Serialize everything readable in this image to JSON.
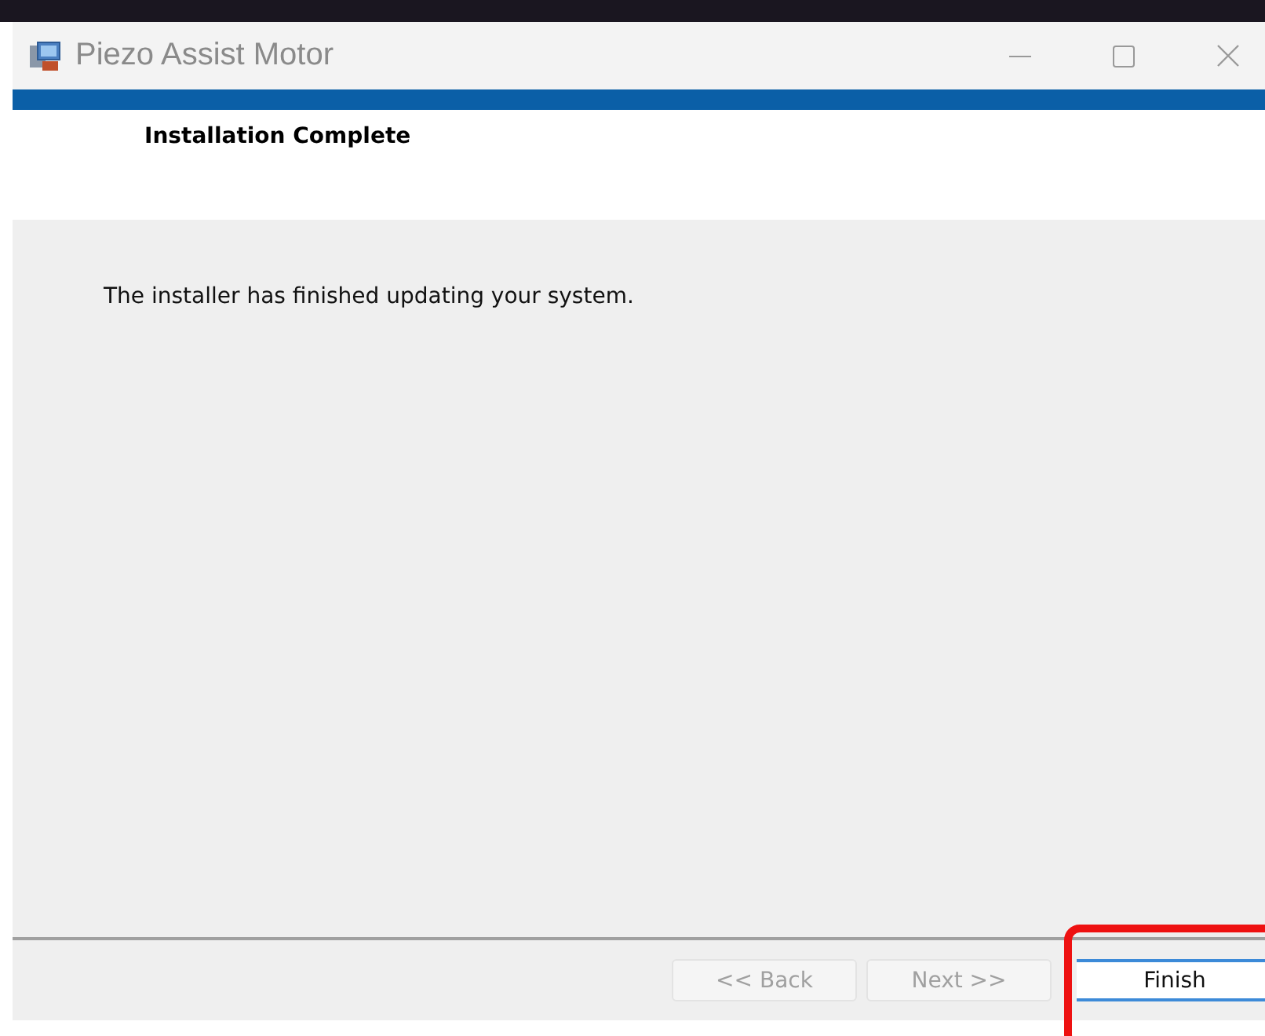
{
  "window": {
    "title": "Piezo Assist Motor"
  },
  "header": {
    "title": "Installation Complete"
  },
  "body": {
    "message": "The installer has finished updating your system."
  },
  "buttons": [
    {
      "label": "<< Back",
      "disabled": true,
      "highlighted": false
    },
    {
      "label": "Next >>",
      "disabled": true,
      "highlighted": false
    },
    {
      "label": "Finish",
      "disabled": false,
      "highlighted": true
    }
  ]
}
